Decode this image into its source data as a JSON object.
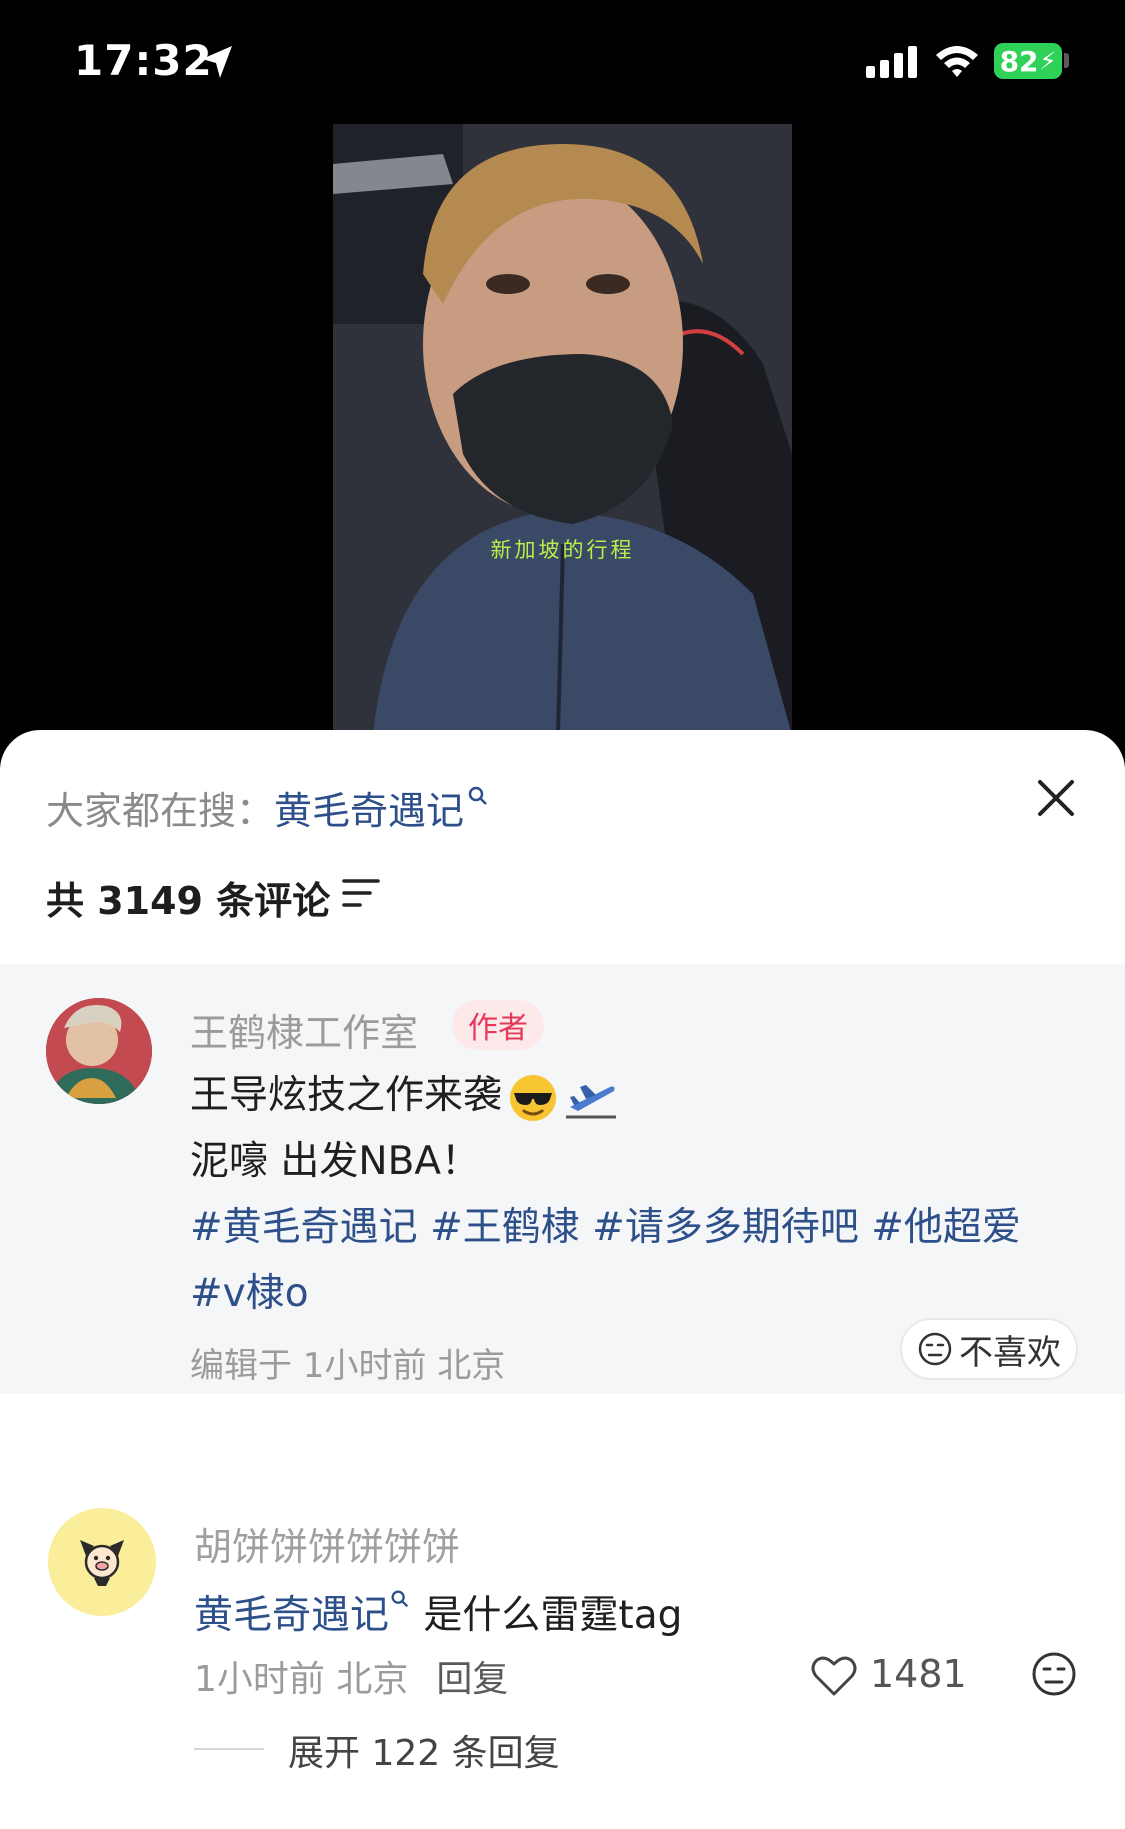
{
  "status_bar": {
    "time": "17:32",
    "battery": "82"
  },
  "video": {
    "subtitle": "新加坡的行程"
  },
  "panel": {
    "trending_label": "大家都在搜：",
    "trending_term": "黄毛奇遇记",
    "comment_count": "共 3149 条评论"
  },
  "author_comment": {
    "name": "王鹤棣工作室",
    "badge": "作者",
    "line1": "王导炫技之作来袭",
    "line2": "泥嚎 出发NBA！",
    "tags_line1": "#黄毛奇遇记 #王鹤棣 #请多多期待吧 #他超爱",
    "tags_line2": "#v棣o",
    "meta": "编辑于  1小时前 北京",
    "dislike_label": "不喜欢"
  },
  "comment2": {
    "name": "胡饼饼饼饼饼饼",
    "text_link": "黄毛奇遇记",
    "text_rest": " 是什么雷霆tag",
    "meta": "1小时前 北京",
    "reply_label": "回复",
    "likes": "1481",
    "expand_label": "展开 122 条回复"
  },
  "colors": {
    "link": "#2d4f8a",
    "badge_text": "#e6395a",
    "battery": "#2fd158"
  }
}
